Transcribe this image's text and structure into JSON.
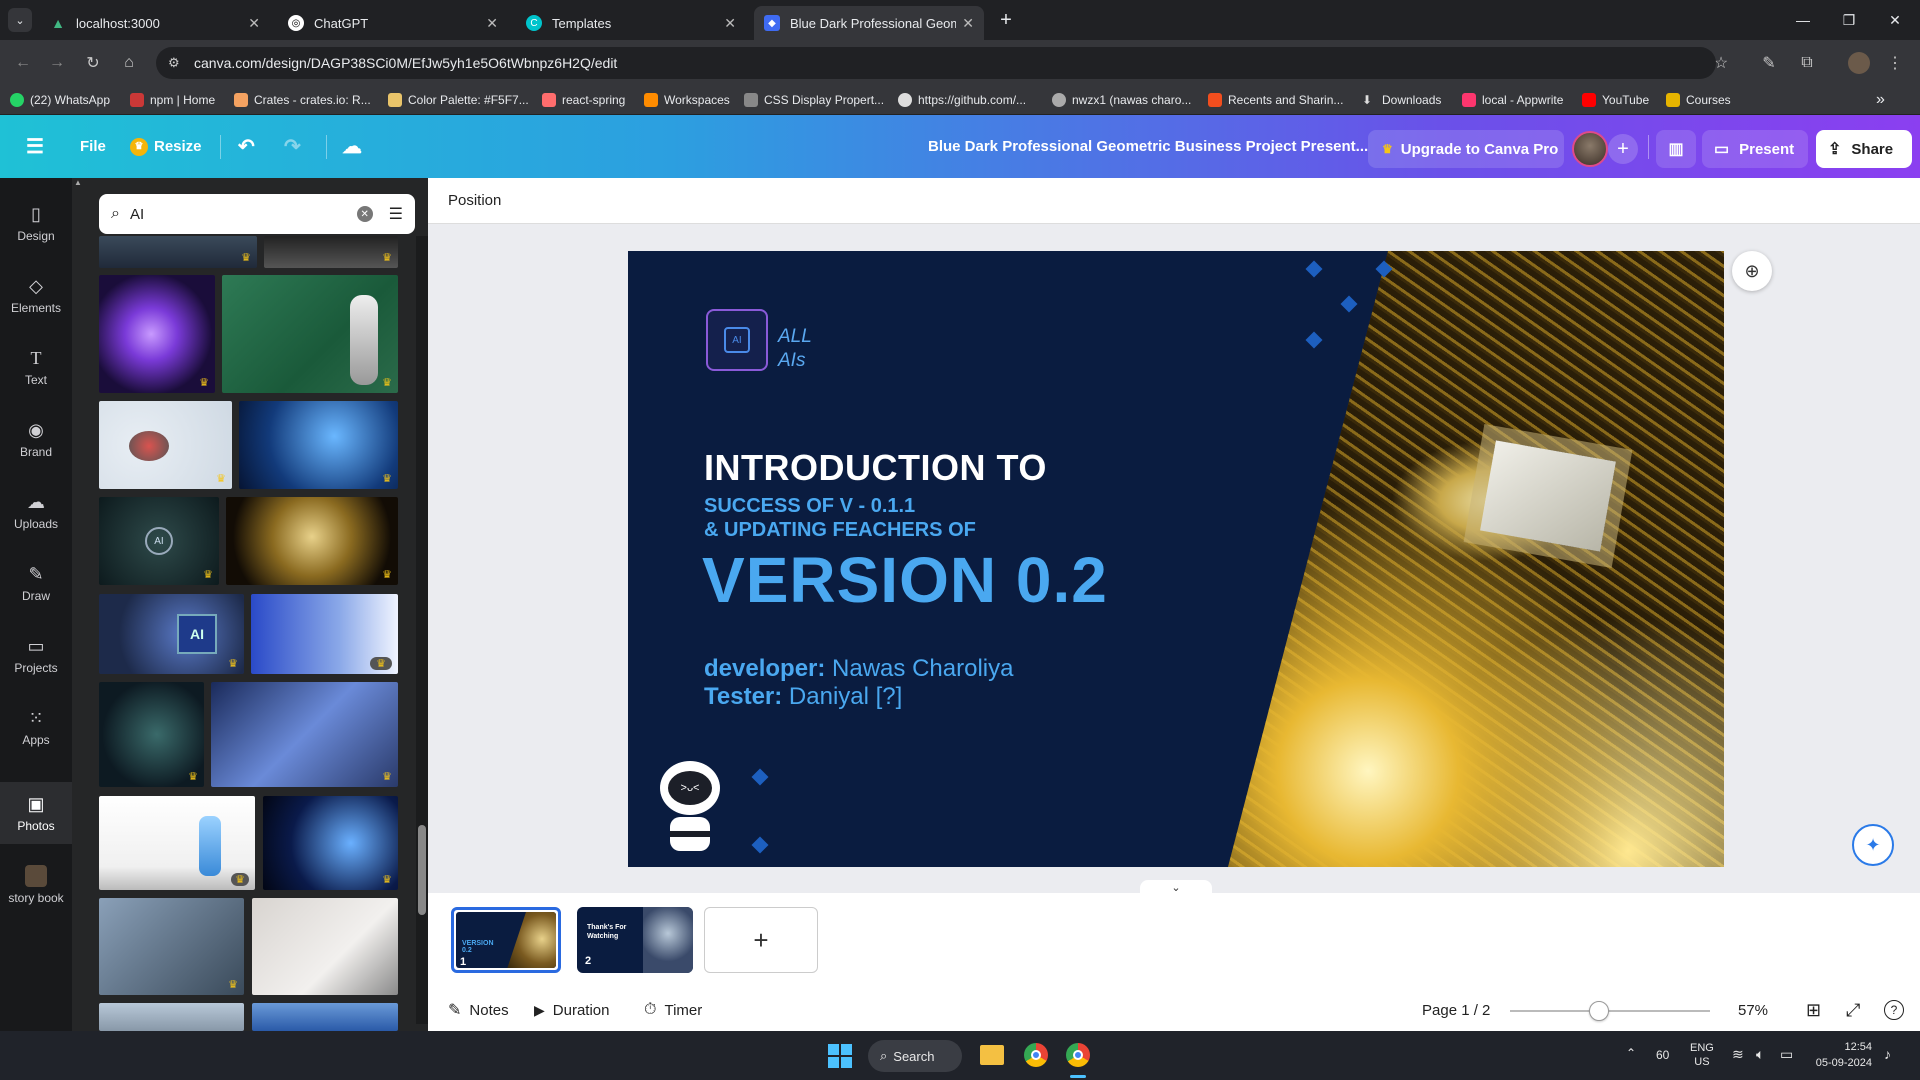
{
  "browser": {
    "tabs": [
      {
        "title": "localhost:3000",
        "color": "#41b883"
      },
      {
        "title": "ChatGPT",
        "color": "#555"
      },
      {
        "title": "Templates",
        "color": "#00c4cc"
      },
      {
        "title": "Blue Dark Professional Geomet",
        "color": "#3f6bf2"
      }
    ],
    "new_tab": "+",
    "url": "canva.com/design/DAGP38SCi0M/EfJw5yh1e5O6tWbnpz6H2Q/edit",
    "bookmarks": [
      {
        "label": "(22) WhatsApp",
        "color": "#25d366"
      },
      {
        "label": "npm | Home",
        "color": "#cb3837"
      },
      {
        "label": "Crates - crates.io: R...",
        "color": "#f4a261"
      },
      {
        "label": "Color Palette: #F5F7...",
        "color": "#e9c46a"
      },
      {
        "label": "react-spring",
        "color": "#ff6d6d"
      },
      {
        "label": "Workspaces",
        "color": "#ff8c00"
      },
      {
        "label": "CSS Display Propert...",
        "color": "#888"
      },
      {
        "label": "https://github.com/...",
        "color": "#ddd"
      },
      {
        "label": "nwzx1 (nawas charo...",
        "color": "#aaa"
      },
      {
        "label": "Recents and Sharin...",
        "color": "#f24e1e"
      },
      {
        "label": "Downloads",
        "color": "#ddd"
      },
      {
        "label": "local - Appwrite",
        "color": "#fd366e"
      },
      {
        "label": "YouTube",
        "color": "#ff0000"
      },
      {
        "label": "Courses",
        "color": "#e6b400"
      }
    ]
  },
  "canva": {
    "file": "File",
    "resize": "Resize",
    "doc_title": "Blue Dark Professional Geometric Business Project Present...",
    "upgrade": "Upgrade to Canva Pro",
    "present": "Present",
    "share": "Share",
    "position_label": "Position"
  },
  "rail": [
    {
      "label": "Design",
      "icon": "layout-icon"
    },
    {
      "label": "Elements",
      "icon": "shapes-icon"
    },
    {
      "label": "Text",
      "icon": "text-icon"
    },
    {
      "label": "Brand",
      "icon": "brand-icon"
    },
    {
      "label": "Uploads",
      "icon": "cloud-upload-icon"
    },
    {
      "label": "Draw",
      "icon": "pen-icon"
    },
    {
      "label": "Projects",
      "icon": "folder-icon"
    },
    {
      "label": "Apps",
      "icon": "grid-icon"
    },
    {
      "label": "Photos",
      "icon": "photo-icon"
    },
    {
      "label": "story book",
      "icon": "avatar-icon"
    }
  ],
  "search": {
    "value": "AI"
  },
  "slide": {
    "logo_line1": "ALL",
    "logo_line2": "AIs",
    "heading": "INTRODUCTION TO",
    "sub1": "SUCCESS OF V - 0.1.1",
    "sub2": "& UPDATING FEACHERS OF",
    "version": "VERSION 0.2",
    "dev_label": "developer:",
    "dev_name": "Nawas Charoliya",
    "tester_label": "Tester:",
    "tester_name": "Daniyal [?]"
  },
  "pages": {
    "p1": "1",
    "p2": "2",
    "p2_title": "Thank's For Watching",
    "add": "+"
  },
  "footer": {
    "notes": "Notes",
    "duration": "Duration",
    "timer": "Timer",
    "page": "Page 1 / 2",
    "zoom": "57%",
    "zoom_fraction": 0.57
  },
  "taskbar": {
    "search": "Search",
    "temp": "60",
    "lang1": "ENG",
    "lang2": "US",
    "time": "12:54",
    "date": "05-09-2024"
  }
}
